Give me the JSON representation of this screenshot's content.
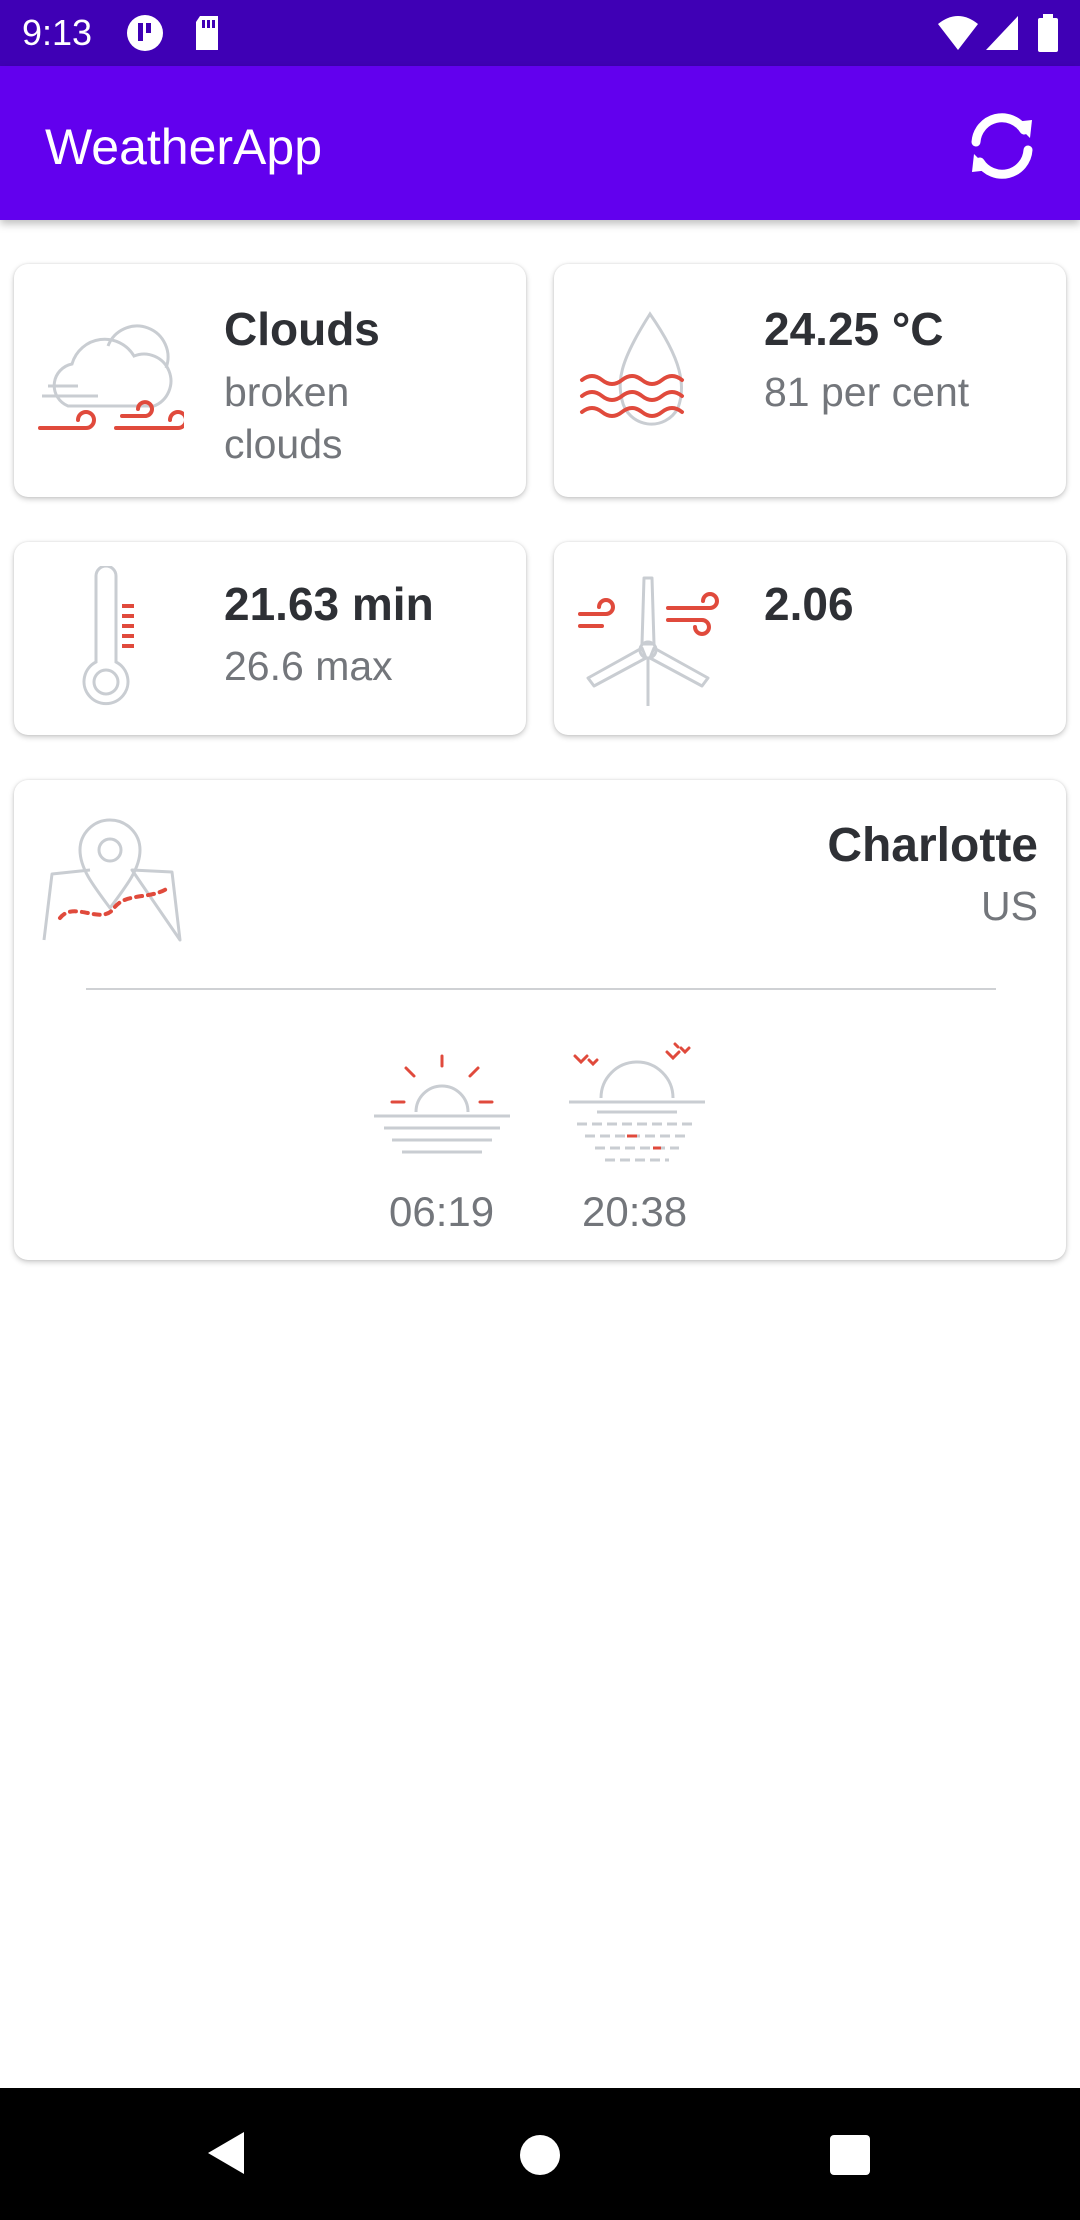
{
  "status_bar": {
    "time": "9:13"
  },
  "app_bar": {
    "title": "WeatherApp"
  },
  "cards": {
    "condition": {
      "title": "Clouds",
      "subtitle": "broken clouds"
    },
    "temperature": {
      "title": "24.25 °C",
      "subtitle": "81 per cent"
    },
    "minmax": {
      "title": "21.63 min",
      "subtitle": "26.6 max"
    },
    "wind": {
      "title": "2.06"
    }
  },
  "location": {
    "city": "Charlotte",
    "country": "US",
    "sunrise": "06:19",
    "sunset": "20:38"
  },
  "colors": {
    "app_bar": "#6200ee",
    "status_bar": "#3f00b5",
    "icon_accent": "#e04a3c",
    "icon_line": "#c9cdd2"
  }
}
